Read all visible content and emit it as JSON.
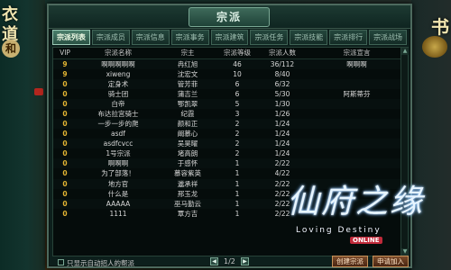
{
  "left_side": {
    "chars": [
      "衣",
      "道"
    ],
    "badge": "和"
  },
  "right_side": {
    "char": "书"
  },
  "panel": {
    "title": "宗派",
    "tabs": [
      {
        "label": "宗派列表",
        "active": true
      },
      {
        "label": "宗派成员",
        "active": false
      },
      {
        "label": "宗派信息",
        "active": false
      },
      {
        "label": "宗派事务",
        "active": false
      },
      {
        "label": "宗派建筑",
        "active": false
      },
      {
        "label": "宗派任务",
        "active": false
      },
      {
        "label": "宗派技能",
        "active": false
      },
      {
        "label": "宗派排行",
        "active": false
      },
      {
        "label": "宗派战场",
        "active": false
      }
    ],
    "columns": [
      "VIP",
      "宗派名称",
      "宗主",
      "宗派等级",
      "宗派人数",
      "宗派宣言"
    ],
    "rows": [
      {
        "vip": "9",
        "name": "啊啊啊啊啊",
        "master": "冉红旭",
        "level": "46",
        "members": "36/112",
        "declaration": "啊啊啊"
      },
      {
        "vip": "9",
        "name": "xiweng",
        "master": "沈宏文",
        "level": "10",
        "members": "8/40",
        "declaration": ""
      },
      {
        "vip": "0",
        "name": "定身术",
        "master": "管芳菲",
        "level": "6",
        "members": "6/32",
        "declaration": ""
      },
      {
        "vip": "0",
        "name": "骑士团",
        "master": "蒲吉兰",
        "level": "6",
        "members": "5/30",
        "declaration": "阿斯蒂芬"
      },
      {
        "vip": "0",
        "name": "白帝",
        "master": "鄂凯翠",
        "level": "5",
        "members": "1/30",
        "declaration": ""
      },
      {
        "vip": "0",
        "name": "布达拉宫骑士",
        "master": "纪霞",
        "level": "3",
        "members": "1/26",
        "declaration": ""
      },
      {
        "vip": "0",
        "name": "一步一步的爬",
        "master": "颜和正",
        "level": "2",
        "members": "1/24",
        "declaration": ""
      },
      {
        "vip": "0",
        "name": "asdf",
        "master": "阚慕心",
        "level": "2",
        "members": "1/24",
        "declaration": ""
      },
      {
        "vip": "0",
        "name": "asdfcvcc",
        "master": "吴昊曜",
        "level": "2",
        "members": "1/24",
        "declaration": ""
      },
      {
        "vip": "0",
        "name": "1号宗派",
        "master": "堵高朗",
        "level": "2",
        "members": "1/24",
        "declaration": ""
      },
      {
        "vip": "0",
        "name": "啊啊啊",
        "master": "于感怀",
        "level": "1",
        "members": "2/22",
        "declaration": ""
      },
      {
        "vip": "0",
        "name": "为了部落！",
        "master": "慕容紫英",
        "level": "1",
        "members": "4/22",
        "declaration": ""
      },
      {
        "vip": "0",
        "name": "地方官",
        "master": "邋承祥",
        "level": "1",
        "members": "2/22",
        "declaration": ""
      },
      {
        "vip": "0",
        "name": "什么是",
        "master": "邢玉龙",
        "level": "1",
        "members": "2/22",
        "declaration": ""
      },
      {
        "vip": "0",
        "name": "AAAAA",
        "master": "巫马勤云",
        "level": "1",
        "members": "2/22",
        "declaration": ""
      },
      {
        "vip": "0",
        "name": "1111",
        "master": "覃方吉",
        "level": "1",
        "members": "2/22",
        "declaration": ""
      }
    ],
    "footer": {
      "checkbox_label": "只显示自动招人的帮派",
      "page": "1/2",
      "btn_create": "创建宗派",
      "btn_apply": "申请加入"
    }
  },
  "logo": {
    "title": "仙府之缘",
    "subtitle": "Loving Destiny",
    "badge": "ONLINE"
  },
  "colors": {
    "accent": "#4a7e6b",
    "vip": "#e2b433",
    "button": "#7a4a2a"
  }
}
